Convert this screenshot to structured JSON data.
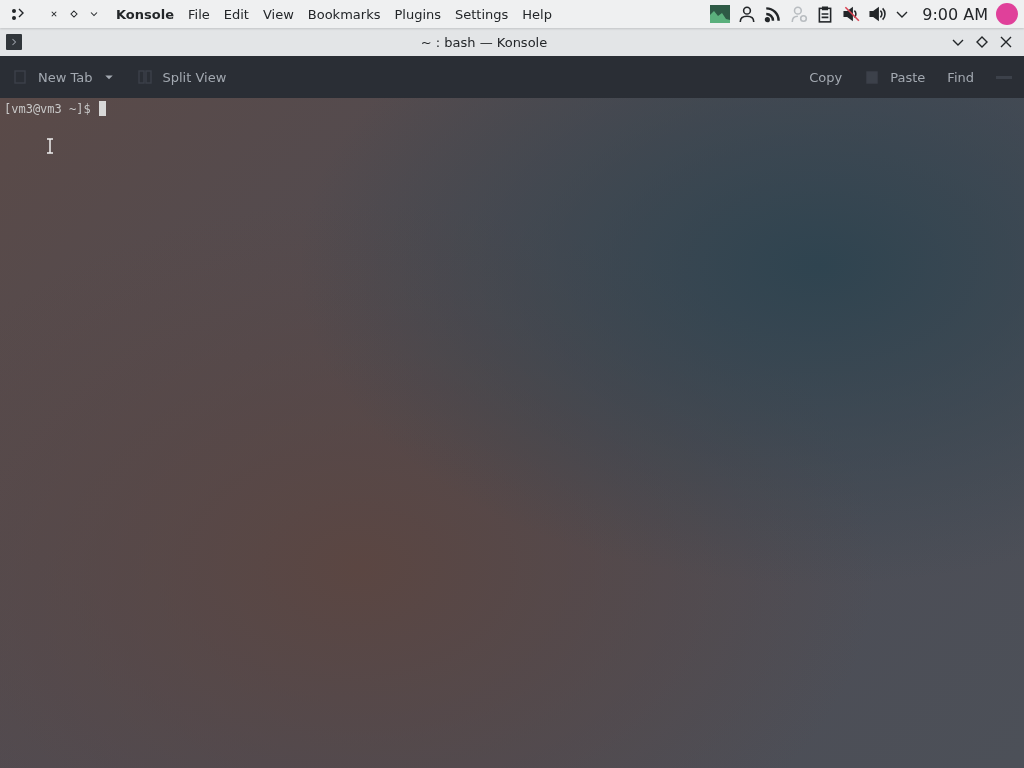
{
  "top_panel": {
    "app_name": "Konsole",
    "menu": [
      "File",
      "Edit",
      "View",
      "Bookmarks",
      "Plugins",
      "Settings",
      "Help"
    ],
    "clock": "9:00 AM"
  },
  "window": {
    "title": "~ : bash — Konsole"
  },
  "toolbar": {
    "left": [
      {
        "label": "New Tab",
        "kind": "menu"
      },
      {
        "label": "Split View",
        "kind": "icon"
      }
    ],
    "right": [
      {
        "label": "Copy",
        "kind": "text"
      },
      {
        "label": "Paste",
        "kind": "icon"
      },
      {
        "label": "Find",
        "kind": "text"
      }
    ]
  },
  "terminal": {
    "prompt": "[vm3@vm3 ~]$"
  }
}
